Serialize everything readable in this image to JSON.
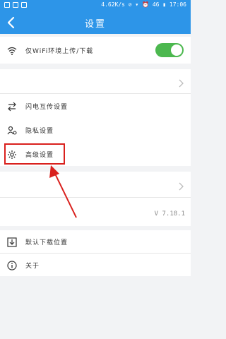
{
  "status_bar": {
    "right_text": "4.62K/s ⊘ ▾ ⏰ 46 ▮ 17:06"
  },
  "header": {
    "title": "设置"
  },
  "wifi_row": {
    "label": "仅WiFi环境上传/下载",
    "toggle_on": true
  },
  "settings": [
    {
      "label": "闪电互传设置",
      "icon": "transfer-icon"
    },
    {
      "label": "隐私设置",
      "icon": "privacy-icon"
    },
    {
      "label": "高级设置",
      "icon": "gear-icon"
    }
  ],
  "version": "V 7.18.1",
  "bottom": [
    {
      "label": "默认下载位置",
      "icon": "download-icon"
    },
    {
      "label": "关于",
      "icon": "info-icon"
    }
  ],
  "colors": {
    "primary": "#2d95e8",
    "toggle": "#4cb84f",
    "highlight": "#d9201d"
  }
}
